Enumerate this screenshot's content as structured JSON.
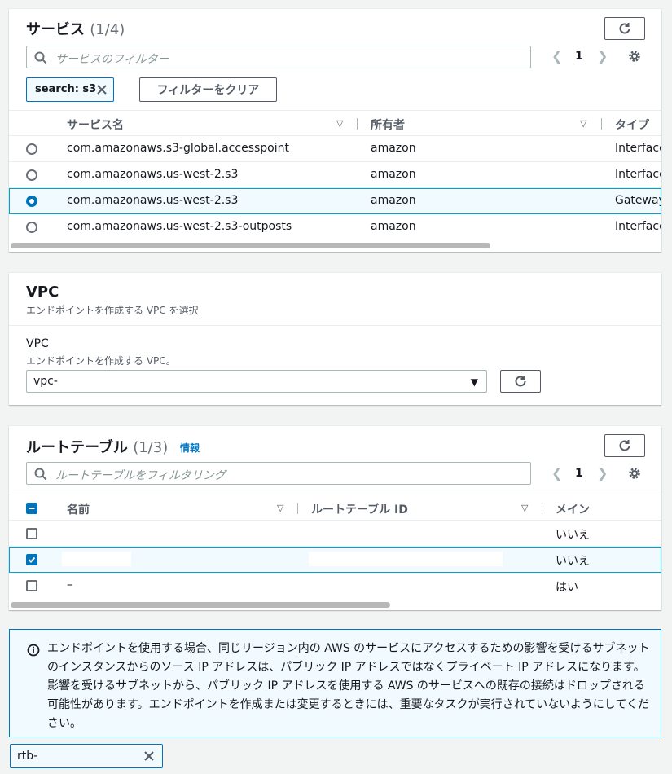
{
  "services": {
    "title": "サービス",
    "count": "(1/4)",
    "search_placeholder": "サービスのフィルター",
    "page": "1",
    "token_label": "search: s3",
    "clear_filters": "フィルターをクリア",
    "columns": [
      "サービス名",
      "所有者",
      "タイプ"
    ],
    "rows": [
      {
        "name": "com.amazonaws.s3-global.accesspoint",
        "owner": "amazon",
        "type": "Interface",
        "selected": false
      },
      {
        "name": "com.amazonaws.us-west-2.s3",
        "owner": "amazon",
        "type": "Interface",
        "selected": false
      },
      {
        "name": "com.amazonaws.us-west-2.s3",
        "owner": "amazon",
        "type": "Gateway",
        "selected": true
      },
      {
        "name": "com.amazonaws.us-west-2.s3-outposts",
        "owner": "amazon",
        "type": "Interface",
        "selected": false
      }
    ]
  },
  "vpc": {
    "title": "VPC",
    "subtitle": "エンドポイントを作成する VPC を選択",
    "field_label": "VPC",
    "field_desc": "エンドポイントを作成する VPC。",
    "value": "vpc-"
  },
  "route_tables": {
    "title": "ルートテーブル",
    "count": "(1/3)",
    "info": "情報",
    "search_placeholder": "ルートテーブルをフィルタリング",
    "page": "1",
    "columns": [
      "名前",
      "ルートテーブル ID",
      "メイン"
    ],
    "rows": [
      {
        "name": "",
        "id": "",
        "main": "いいえ",
        "checked": false
      },
      {
        "name": "",
        "id": "",
        "main": "いいえ",
        "checked": true
      },
      {
        "name": "–",
        "id": "",
        "main": "はい",
        "checked": false
      }
    ]
  },
  "alert": {
    "message": "エンドポイントを使用する場合、同じリージョン内の AWS のサービスにアクセスするための影響を受けるサブネットのインスタンスからのソース IP アドレスは、パブリック IP アドレスではなくプライベート IP アドレスになります。影響を受けるサブネットから、パブリック IP アドレスを使用する AWS のサービスへの既存の接続はドロップされる可能性があります。エンドポイントを作成または変更するときには、重要なタスクが実行されていないようにしてください。"
  },
  "selected_token": "rtb-",
  "colors": {
    "accent": "#0073bb",
    "selected_bg": "#f1faff",
    "border": "#eaeded"
  }
}
